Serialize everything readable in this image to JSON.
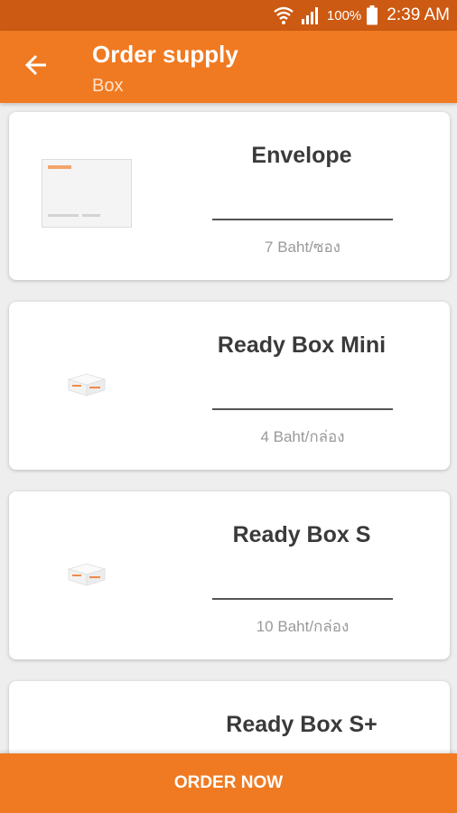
{
  "status_bar": {
    "battery_percent": "100%",
    "time": "2:39 AM",
    "icons": [
      "wifi-calling-icon",
      "signal-icon",
      "battery-icon"
    ]
  },
  "app_bar": {
    "title": "Order supply",
    "subtitle": "Box",
    "back_icon": "arrow-left-icon"
  },
  "products": [
    {
      "name": "Envelope",
      "price": "7 Baht/ซอง",
      "image": "envelope"
    },
    {
      "name": "Ready Box Mini",
      "price": "4 Baht/กล่อง",
      "image": "box"
    },
    {
      "name": "Ready Box S",
      "price": "10 Baht/กล่อง",
      "image": "box"
    },
    {
      "name": "Ready Box S+",
      "price": "",
      "image": "box"
    }
  ],
  "order_button": {
    "label": "ORDER NOW"
  },
  "colors": {
    "primary": "#f07a22",
    "status_bar": "#cc5a12",
    "background": "#eeeeee"
  }
}
